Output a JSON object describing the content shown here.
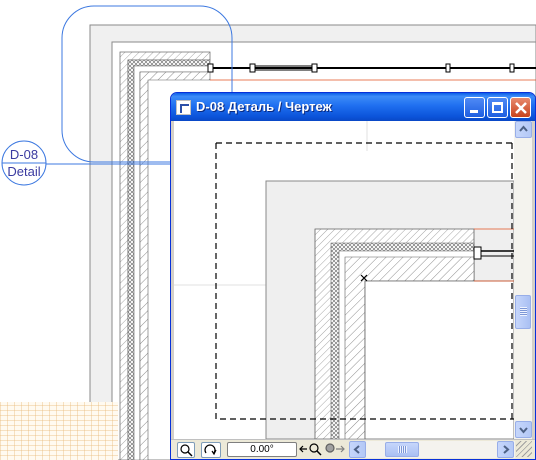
{
  "background_plan": {
    "marker": {
      "line1": "D-08",
      "line2": "Detail"
    },
    "colors": {
      "marker_blue": "#3c78e0",
      "wall_line": "#000000",
      "accent_red": "#e05020",
      "floor_grid": "#e8b878"
    }
  },
  "window": {
    "title": "D-08  Деталь / Чертеж",
    "controls": {
      "minimize": "minimize",
      "maximize": "maximize",
      "close": "close"
    },
    "zoom_value": "0.00°",
    "colors": {
      "titlebar": "#1f6ff0",
      "close_button": "#d75a36",
      "frame": "#0831d9"
    }
  }
}
